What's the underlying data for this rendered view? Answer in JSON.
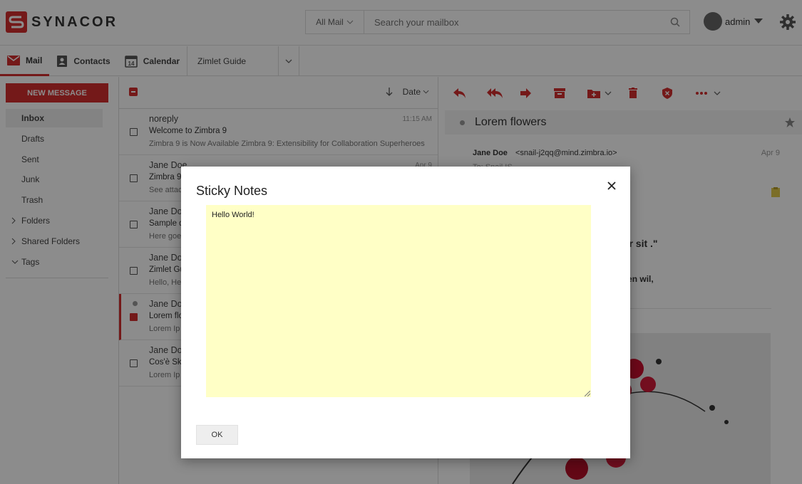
{
  "brand": {
    "name": "SYNACOR",
    "accent": "#d32f2f"
  },
  "search": {
    "scope": "All Mail",
    "placeholder": "Search your mailbox"
  },
  "user": {
    "name": "admin"
  },
  "nav": {
    "tabs": [
      {
        "label": "Mail",
        "icon": "mail-icon"
      },
      {
        "label": "Contacts",
        "icon": "contacts-icon"
      },
      {
        "label": "Calendar",
        "icon": "calendar-icon"
      },
      {
        "label": "Zimlet Guide"
      }
    ],
    "calendar_day": "14"
  },
  "sidebar": {
    "new_message": "NEW MESSAGE",
    "folders": [
      "Inbox",
      "Drafts",
      "Sent",
      "Junk",
      "Trash",
      "Folders",
      "Shared Folders",
      "Tags"
    ]
  },
  "list": {
    "sort_label": "Date",
    "messages": [
      {
        "from": "noreply",
        "time": "11:15 AM",
        "subject": "Welcome to Zimbra 9",
        "preview": "Zimbra 9 is Now Available Zimbra 9: Extensibility for Collaboration Superheroes"
      },
      {
        "from": "Jane Doe",
        "time": "Apr 9",
        "subject": "Zimbra 9",
        "preview": "See attached"
      },
      {
        "from": "Jane Doe",
        "time": "",
        "subject": "Sample d",
        "preview": "Here goe"
      },
      {
        "from": "Jane Doe",
        "time": "",
        "subject": "Zimlet Gu",
        "preview": "Hello, He"
      },
      {
        "from": "Jane Doe",
        "time": "",
        "subject": "Lorem flo",
        "preview": "Lorem Ip"
      },
      {
        "from": "Jane Doe",
        "time": "",
        "subject": "Cos'è Sk",
        "preview": "Lorem Ip"
      }
    ]
  },
  "reader": {
    "subject": "Lorem flowers",
    "from_name": "Jane Doe",
    "from_email": "<snail-j2qq@mind.zimbra.io>",
    "date": "Apr 9",
    "to_label": "To:",
    "to_value": "Snail IS",
    "heading": "dolorem ipsum quia dolor sit .\"",
    "paragraph": "die het zoekt en die het hebben wil,"
  },
  "dialog": {
    "title": "Sticky Notes",
    "note_text": "Hello World!",
    "ok_label": "OK",
    "note_color": "#ffffc6"
  }
}
